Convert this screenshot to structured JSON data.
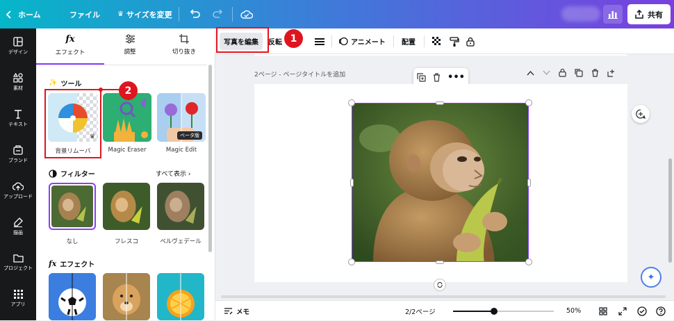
{
  "header": {
    "home_label": "ホーム",
    "file_label": "ファイル",
    "resize_label": "サイズを変更",
    "share_label": "共有"
  },
  "leftbar": {
    "items": [
      {
        "label": "デザイン",
        "icon": "layout-icon"
      },
      {
        "label": "素材",
        "icon": "shapes-icon"
      },
      {
        "label": "テキスト",
        "icon": "text-icon"
      },
      {
        "label": "ブランド",
        "icon": "brand-icon"
      },
      {
        "label": "アップロード",
        "icon": "upload-icon"
      },
      {
        "label": "描画",
        "icon": "draw-icon"
      },
      {
        "label": "プロジェクト",
        "icon": "folder-icon"
      },
      {
        "label": "アプリ",
        "icon": "apps-icon"
      }
    ]
  },
  "panel": {
    "tabs": [
      {
        "label": "エフェクト",
        "icon": "fx-icon"
      },
      {
        "label": "調整",
        "icon": "sliders-icon"
      },
      {
        "label": "切り抜き",
        "icon": "crop-icon"
      }
    ],
    "tools_title": "ツール",
    "tools": [
      {
        "label": "背景リムーバ"
      },
      {
        "label": "Magic Eraser"
      },
      {
        "label": "Magic Edit",
        "badge": "ベータ版"
      }
    ],
    "filters_title": "フィルター",
    "show_all": "すべて表示 ›",
    "filters": [
      {
        "label": "なし"
      },
      {
        "label": "フレスコ"
      },
      {
        "label": "ベルヴェデール"
      }
    ],
    "effects_title": "エフェクト"
  },
  "toolbar": {
    "edit_photo": "写真を編集",
    "flip": "反転",
    "animate": "アニメート",
    "position": "配置"
  },
  "canvas": {
    "page_title": "2ページ - ページタイトルを追加"
  },
  "bottombar": {
    "notes": "メモ",
    "page_count": "2/2ページ",
    "zoom": "50%",
    "zoom_level": 0.5
  },
  "annotations": {
    "badge1": "1",
    "badge2": "2"
  },
  "colors": {
    "accent": "#8b3dff",
    "annotation_red": "#e0141e",
    "sidebar_bg": "#18191b"
  }
}
